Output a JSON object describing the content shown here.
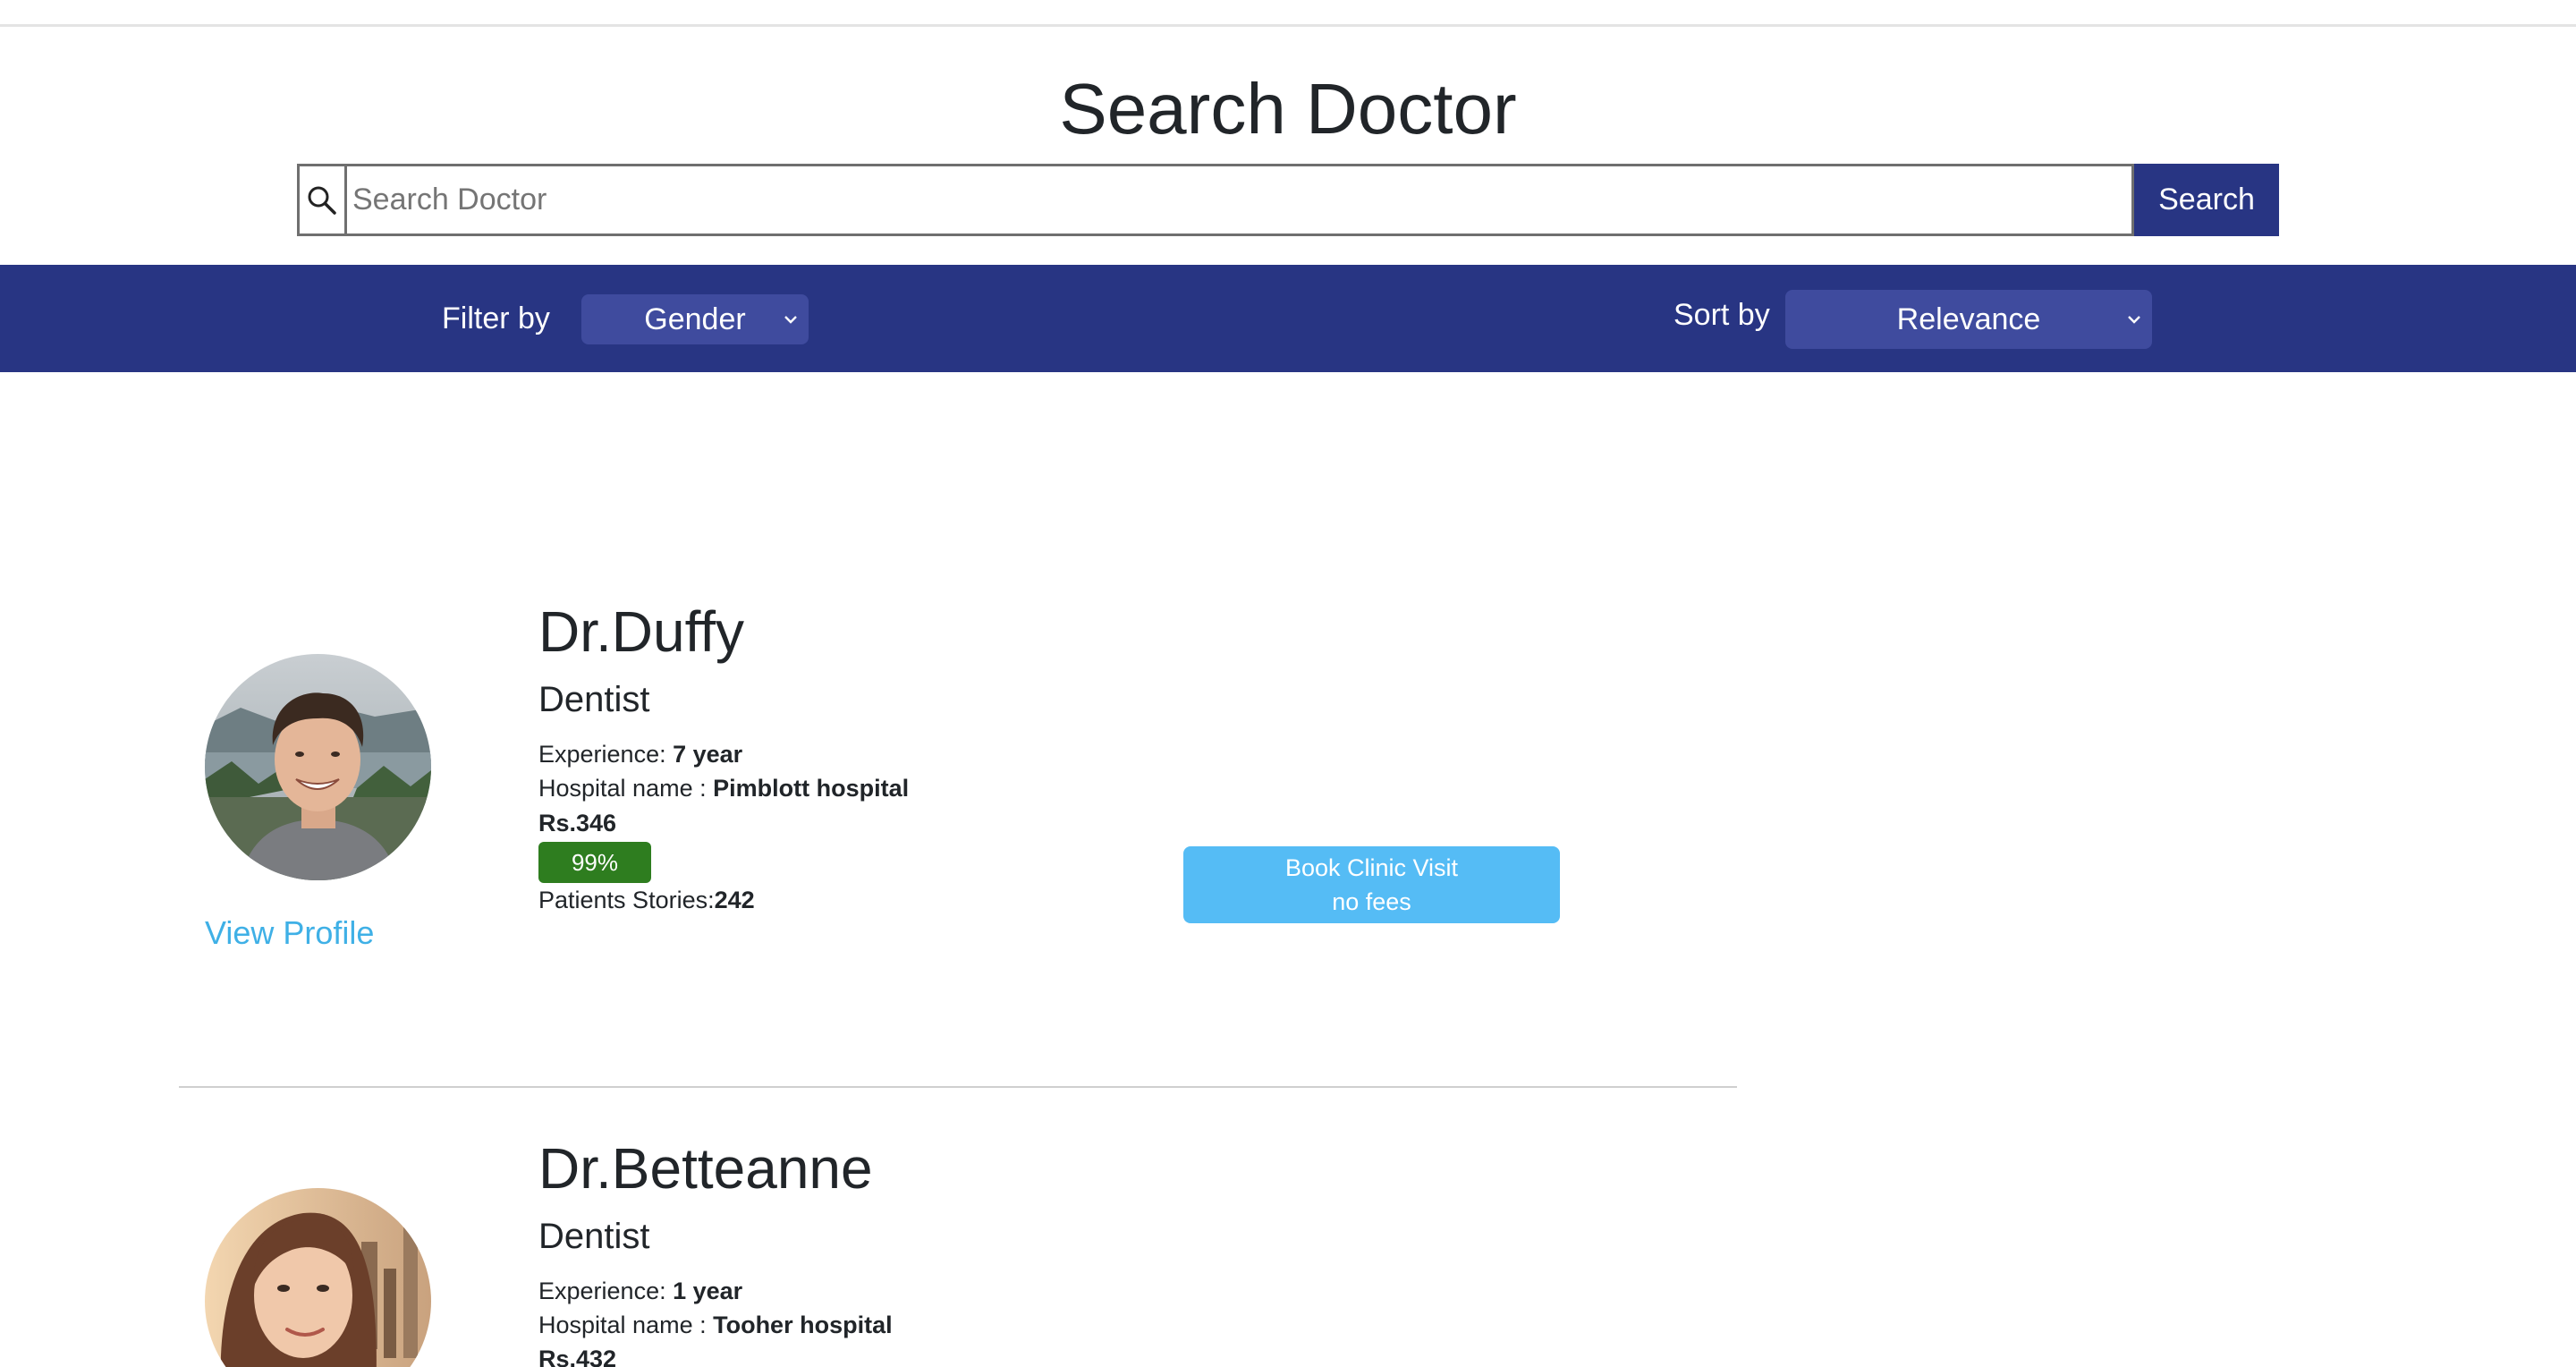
{
  "header": {
    "title": "Search Doctor"
  },
  "search": {
    "placeholder": "Search Doctor",
    "value": "",
    "button_label": "Search",
    "icon": "search-icon"
  },
  "filters": {
    "filter_label": "Filter by",
    "gender_selected": "Gender",
    "sort_label": "Sort by",
    "sort_selected": "Relevance"
  },
  "doctors": [
    {
      "name": "Dr.Duffy",
      "specialty": "Dentist",
      "experience_label": "Experience: ",
      "experience": "7 year",
      "hospital_label": "Hospital name : ",
      "hospital": "Pimblott hospital",
      "fee": "Rs.346",
      "rating": "99%",
      "stories_label": "Patients Stories:",
      "stories": "242",
      "view_profile": "View Profile",
      "book_line1": "Book Clinic Visit",
      "book_line2": "no fees"
    },
    {
      "name": "Dr.Betteanne",
      "specialty": "Dentist",
      "experience_label": "Experience: ",
      "experience": "1 year",
      "hospital_label": "Hospital name : ",
      "hospital": "Tooher hospital",
      "fee": "Rs.432"
    }
  ],
  "colors": {
    "brand": "#283583",
    "select_bg": "#3f4b9e",
    "rating_green": "#2e7d1f",
    "book_button": "#55bcf5",
    "link": "#3fb0e6"
  }
}
